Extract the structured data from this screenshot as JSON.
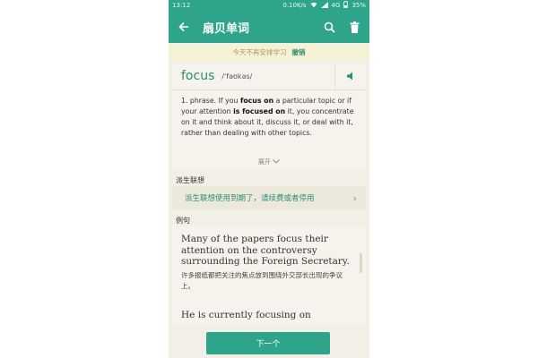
{
  "status_bar": {
    "time": "13:12",
    "network": "0.10K/s",
    "signal": "4G",
    "battery": "35%"
  },
  "app_bar": {
    "title": "扇贝单词"
  },
  "notice": {
    "text": "今天不再安排学习",
    "undo": "撤销"
  },
  "word": {
    "headword": "focus",
    "phonetic": "/ˈfəʊkəs/",
    "definition": {
      "prefix": "1. phrase. If you ",
      "bold1": "focus on",
      "mid1": " a particular topic or if your attention ",
      "bold2": "is focused on",
      "mid2": " it, you concentrate on it and think about it, discuss it, or deal with it, rather than dealing with other topics."
    },
    "expand_label": "展开"
  },
  "derivatives": {
    "heading": "派生联想",
    "message": "派生联想使用到期了，请续费或者停用"
  },
  "examples": {
    "heading": "例句",
    "items": [
      {
        "en": "Many of the papers focus their attention on the controversy surrounding the Foreign Secretary.",
        "zh": "许多报纸都把关注的焦点放到围绕外交部长出现的争议上。"
      },
      {
        "en": "He is currently focusing on",
        "zh": ""
      }
    ]
  },
  "next_button": "下一个",
  "colors": {
    "accent": "#2ea58a",
    "accent_text": "#2e8c74",
    "notice_bg": "#f6f2d8",
    "background": "#f1efe6"
  },
  "icons": [
    "back-arrow-icon",
    "search-icon",
    "trash-icon",
    "speaker-icon",
    "chevron-down-icon",
    "chevron-right-icon",
    "wifi-icon",
    "signal-icon",
    "battery-icon"
  ]
}
